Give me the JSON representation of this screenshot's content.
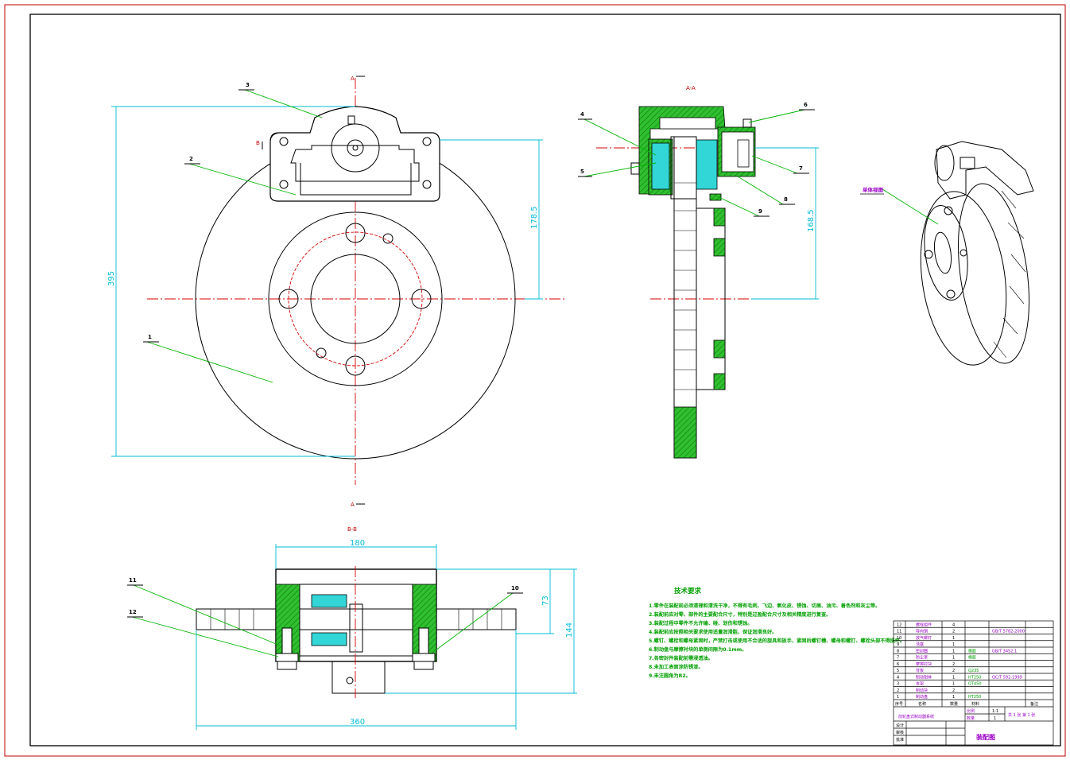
{
  "drawing": {
    "main_view_markers": {
      "section_a_top": "A",
      "section_a_bottom": "A",
      "section_b": "B"
    },
    "views": {
      "section_aa_title": "A-A",
      "section_bb_title": "B-B",
      "isometric_label": "单体视图"
    },
    "dimensions": {
      "disc_diameter": "395",
      "caliper_height": "178.5",
      "section_height": "168.5",
      "caliper_width": "180",
      "flange_width": "360",
      "depth_total": "144",
      "depth_upper": "73"
    },
    "part_labels": {
      "main": [
        "3",
        "2",
        "1"
      ],
      "section": [
        "4",
        "5",
        "6",
        "7",
        "8",
        "9"
      ],
      "bottom": [
        "11",
        "12",
        "10"
      ]
    },
    "technical_requirements": {
      "title": "技术要求",
      "items": [
        "1.零件在装配前必须清理和清洗干净，不得有毛刺、飞边、氧化皮、锈蚀、切屑、油污、着色剂和灰尘等。",
        "2.装配前应对零、部件的主要配合尺寸，特别是过盈配合尺寸及相关精度进行复查。",
        "3.装配过程中零件不允许磕、碰、划伤和锈蚀。",
        "4.装配前应按照相关要求使用适量润滑脂，保证润滑良好。",
        "5.螺钉、螺栓和螺母紧固时，严禁打击或使用不合适的旋具和扳手，紧固后螺钉槽、螺母和螺钉、螺栓头部不得损坏。",
        "6.制动盘与摩擦衬块的单侧间隙为0.1mm。",
        "7.各密封件装配前需浸透油。",
        "8.未加工表面涂防锈漆。",
        "9.未注圆角为R2。"
      ]
    },
    "title_block": {
      "parts_rows": [
        {
          "no": "12",
          "name": "螺栓组件",
          "qty": "4",
          "material": "",
          "std": ""
        },
        {
          "no": "11",
          "name": "导向销",
          "qty": "2",
          "material": "",
          "std": "GB/T 5782-2000"
        },
        {
          "no": "10",
          "name": "放气螺钉",
          "qty": "1",
          "material": "",
          "std": ""
        },
        {
          "no": "9",
          "name": "活塞",
          "qty": "1",
          "material": "",
          "std": ""
        },
        {
          "no": "8",
          "name": "密封圈",
          "qty": "1",
          "material": "橡胶",
          "std": "GB/T 3452.1"
        },
        {
          "no": "7",
          "name": "防尘罩",
          "qty": "1",
          "material": "橡胶",
          "std": ""
        },
        {
          "no": "6",
          "name": "摩擦衬块",
          "qty": "2",
          "material": "",
          "std": ""
        },
        {
          "no": "5",
          "name": "背板",
          "qty": "2",
          "material": "Q235",
          "std": ""
        },
        {
          "no": "4",
          "name": "制动钳体",
          "qty": "1",
          "material": "HT250",
          "std": "QC/T 592-1999"
        },
        {
          "no": "3",
          "name": "支架",
          "qty": "1",
          "material": "QT450",
          "std": ""
        },
        {
          "no": "2",
          "name": "制动块",
          "qty": "2",
          "material": "",
          "std": ""
        },
        {
          "no": "1",
          "name": "制动盘",
          "qty": "1",
          "material": "HT250",
          "std": ""
        }
      ],
      "header": [
        "序号",
        "名称",
        "数量",
        "材料",
        "备注"
      ],
      "scale_label": "比例",
      "scale_value": "1:1",
      "qty_label": "数量",
      "qty_value": "1",
      "sheet_label": "共 1 张 第 1 张",
      "product_name": "前轮盘式制动器系统",
      "drawing_title": "装配图",
      "role_labels": [
        "设计",
        "审核",
        "批准"
      ]
    }
  },
  "colors": {
    "frame": "#000000",
    "border": "#c00000",
    "center_line": "#d40000",
    "dimension": "#00bcd4",
    "leader": "#00b400",
    "note": "#00a000"
  }
}
